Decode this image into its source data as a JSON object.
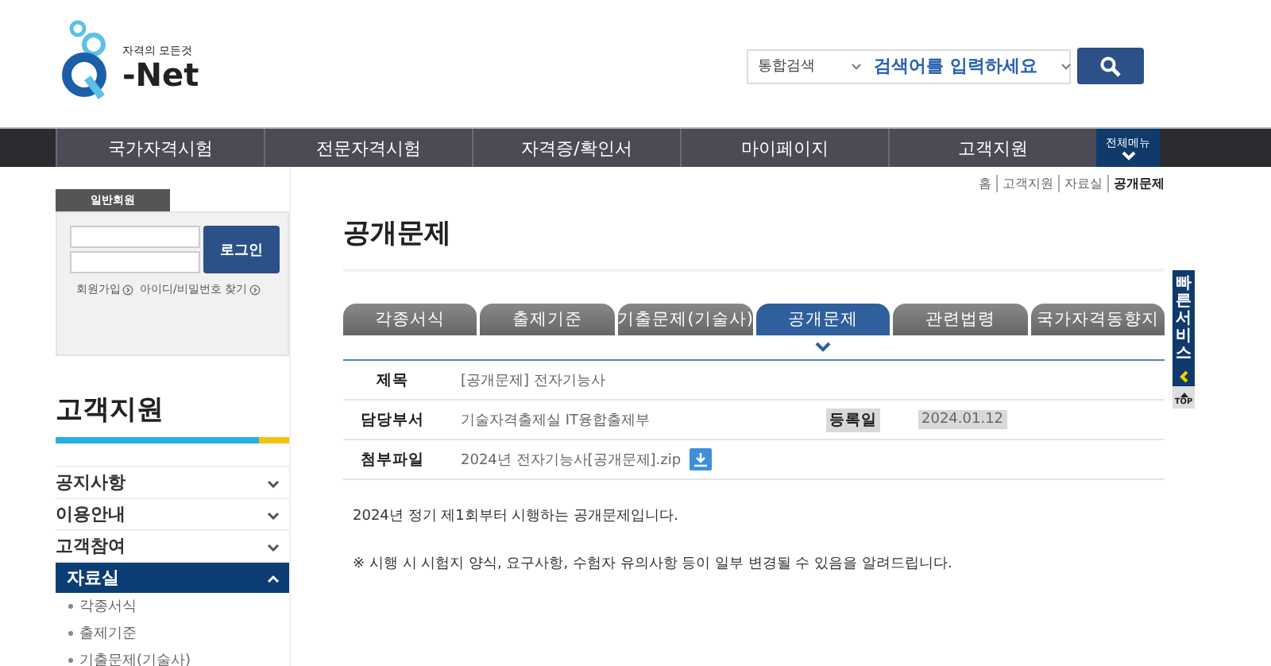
{
  "logo": {
    "tagline": "자격의 모든것",
    "text": "-Net"
  },
  "search": {
    "scope": "통합검색",
    "placeholder": "검색어를 입력하세요"
  },
  "nav": {
    "items": [
      "국가자격시험",
      "전문자격시험",
      "자격증/확인서",
      "마이페이지",
      "고객지원"
    ],
    "all_menu": "전체메뉴"
  },
  "login": {
    "tab": "일반회원",
    "button": "로그인",
    "links": [
      "회원가입",
      "아이디/비밀번호 찾기"
    ]
  },
  "sidebar": {
    "title": "고객지원",
    "items": [
      {
        "label": "공지사항",
        "expanded": false
      },
      {
        "label": "이용안내",
        "expanded": false
      },
      {
        "label": "고객참여",
        "expanded": false
      },
      {
        "label": "자료실",
        "expanded": true,
        "children": [
          "각종서식",
          "출제기준",
          "기출문제(기술사)"
        ]
      }
    ]
  },
  "breadcrumb": [
    "홈",
    "고객지원",
    "자료실",
    "공개문제"
  ],
  "page_title": "공개문제",
  "tabs": [
    {
      "label": "각종서식",
      "selected": false
    },
    {
      "label": "출제기준",
      "selected": false
    },
    {
      "label": "기출문제(기술사)",
      "selected": false
    },
    {
      "label": "공개문제",
      "selected": true
    },
    {
      "label": "관련법령",
      "selected": false
    },
    {
      "label": "국가자격동향지",
      "selected": false
    }
  ],
  "detail": {
    "title_label": "제목",
    "title": "[공개문제] 전자기능사",
    "dept_label": "담당부서",
    "dept": "기술자격출제실 IT융합출제부",
    "date_label": "등록일",
    "date": "2024.01.12",
    "file_label": "첨부파일",
    "file": "2024년 전자기능사[공개문제].zip"
  },
  "body": [
    "2024년 정기 제1회부터 시행하는 공개문제입니다.",
    "※ 시행 시 시험지 양식, 요구사항, 수험자 유의사항 등이 일부 변경될 수 있음을 알려드립니다."
  ],
  "quick": {
    "label": "빠른서비스",
    "top": "TOP"
  }
}
